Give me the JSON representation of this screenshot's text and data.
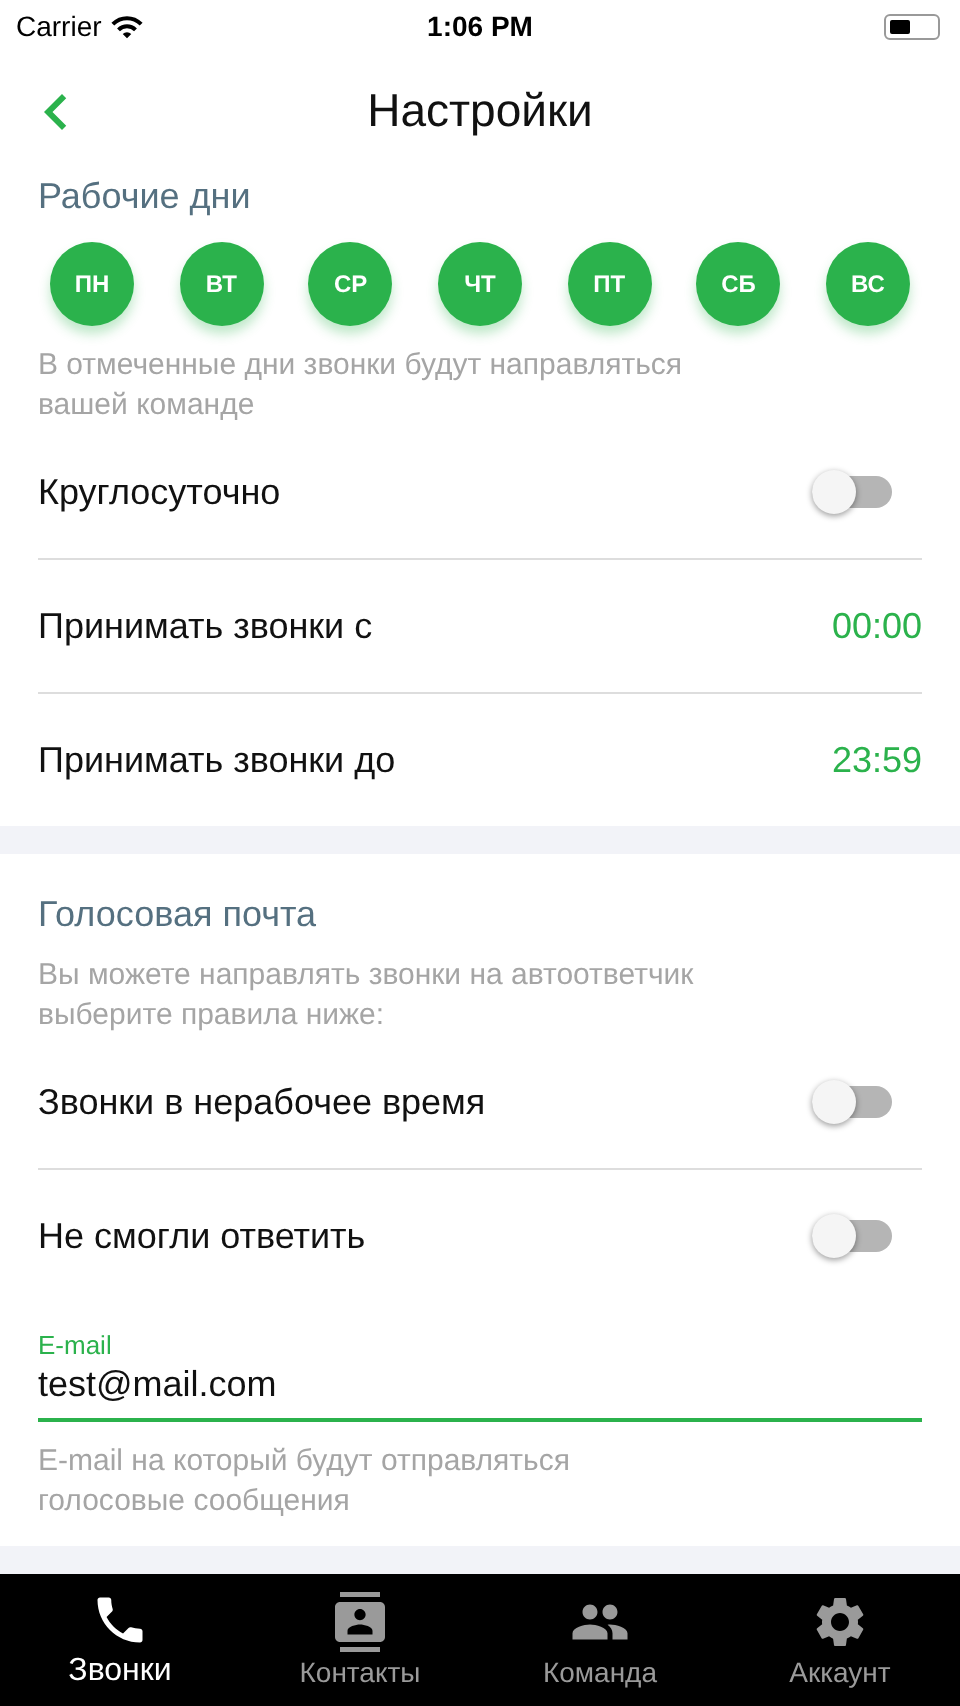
{
  "status_bar": {
    "carrier": "Carrier",
    "time": "1:06 PM"
  },
  "header": {
    "title": "Настройки"
  },
  "work_days": {
    "title": "Рабочие дни",
    "days": [
      {
        "label": "ПН",
        "selected": true
      },
      {
        "label": "ВТ",
        "selected": true
      },
      {
        "label": "СР",
        "selected": true
      },
      {
        "label": "ЧТ",
        "selected": true
      },
      {
        "label": "ПТ",
        "selected": true
      },
      {
        "label": "СБ",
        "selected": true
      },
      {
        "label": "ВС",
        "selected": true
      }
    ],
    "hint": "В отмеченные дни звонки будут направляться вашей команде",
    "rows": [
      {
        "kind": "toggle",
        "label": "Круглосуточно",
        "on": false
      },
      {
        "kind": "time",
        "label": "Принимать звонки с",
        "value": "00:00"
      },
      {
        "kind": "time",
        "label": "Принимать звонки до",
        "value": "23:59"
      }
    ]
  },
  "voicemail": {
    "title": "Голосовая почта",
    "hint": "Вы можете направлять звонки на автоответчик выберите правила ниже:",
    "rows": [
      {
        "kind": "toggle",
        "label": "Звонки в нерабочее время",
        "on": false
      },
      {
        "kind": "toggle",
        "label": "Не смогли ответить",
        "on": false
      }
    ],
    "email": {
      "label": "E-mail",
      "value": "test@mail.com",
      "focused": true
    },
    "email_hint": "E-mail на который будут отправляться голосовые сообщения"
  },
  "tab_bar": [
    {
      "kind": "phone",
      "label": "Звонки",
      "selected": true
    },
    {
      "kind": "contacts",
      "label": "Контакты",
      "selected": false
    },
    {
      "kind": "team",
      "label": "Команда",
      "selected": false
    },
    {
      "kind": "settings",
      "label": "Аккаунт",
      "selected": false
    }
  ]
}
